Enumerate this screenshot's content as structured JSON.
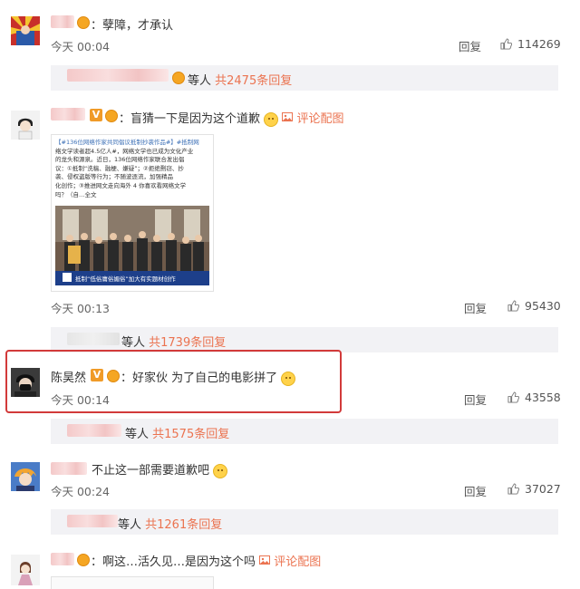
{
  "comments": [
    {
      "text": "：孽障，才承认",
      "time": "今天 00:04",
      "reply": "回复",
      "likes": "114269",
      "thread": {
        "suffix": "等人 ",
        "count": "共2475条回复"
      }
    },
    {
      "text": "：盲猜一下是因为这个道歉",
      "pic_link": "评论配图",
      "time": "今天 00:13",
      "reply": "回复",
      "likes": "95430",
      "image": {
        "text_line1": "【#136位网络作家共同倡议抵制抄袭作品#】#抵制网",
        "text_line2": "络文学读者超4.5亿人#，网络文学也已成为文化产业",
        "text_line3": "的龙头和源泉。近日，136位网络作家联合发出倡",
        "text_line4": "议：①抵制“洗稿、融梗、嫌疑”；②拒绝剽窃、抄",
        "text_line5": "袭、侵权盗版等行为；不随波逐流，加强精品",
        "text_line6": "化创作；③推进网文走向海外 4 你喜欢看网络文学",
        "text_line7": "吗？（自…全文",
        "caption": "抵制“低俗庸俗媚俗”加大有实题材创作"
      },
      "thread": {
        "suffix": "等人 ",
        "count": "共1739条回复"
      }
    },
    {
      "name": "陈昊然",
      "text": "：好家伙 为了自己的电影拼了",
      "time": "今天 00:14",
      "reply": "回复",
      "likes": "43558",
      "thread": {
        "suffix": "等人 ",
        "count": "共1575条回复"
      }
    },
    {
      "text": "不止这一部需要道歉吧",
      "time": "今天 00:24",
      "reply": "回复",
      "likes": "37027",
      "thread": {
        "suffix": "等人 ",
        "count": "共1261条回复"
      }
    },
    {
      "text": "：啊这…活久见…是因为这个吗",
      "pic_link": "评论配图"
    }
  ]
}
